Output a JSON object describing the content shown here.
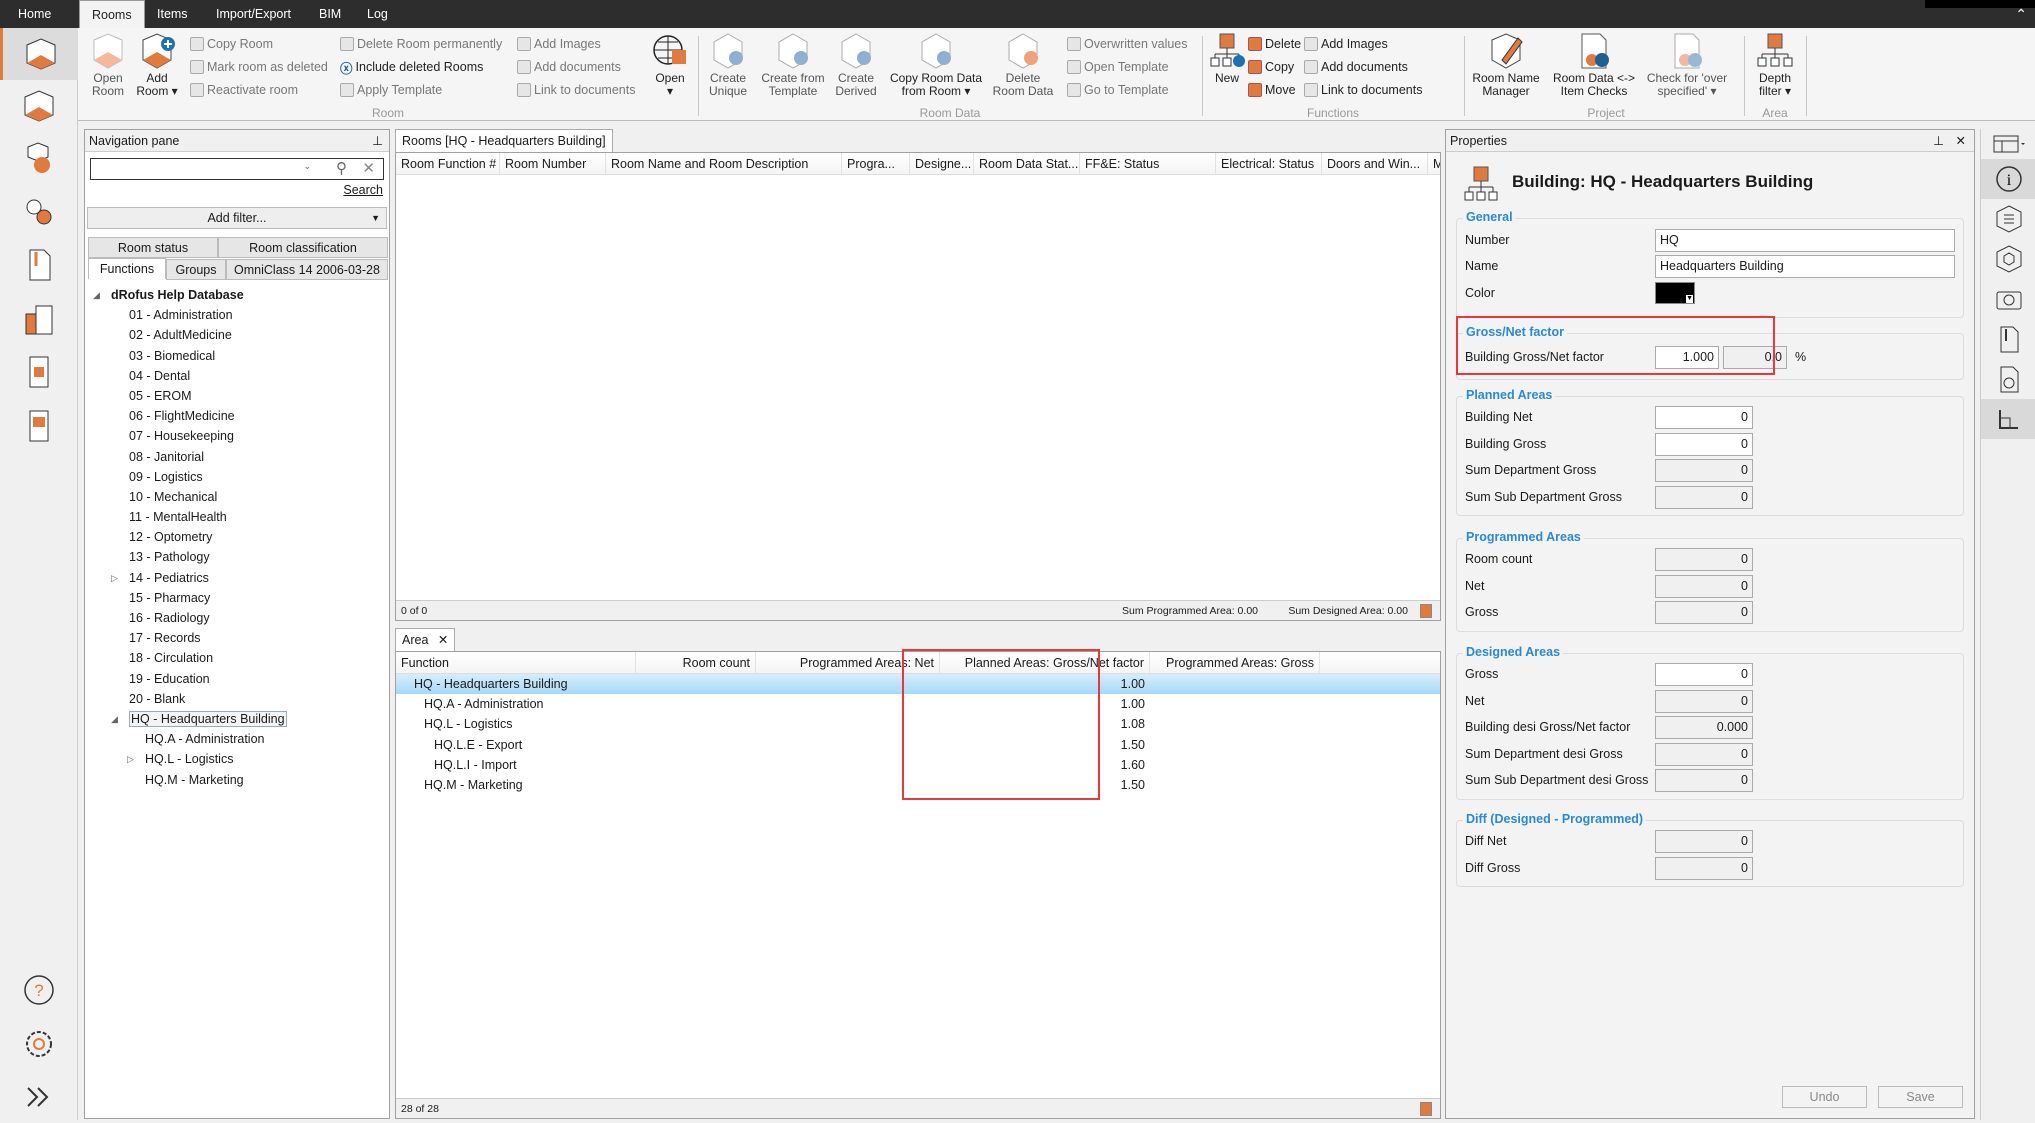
{
  "menu_tabs": [
    {
      "label": "Home"
    },
    {
      "label": "Rooms"
    },
    {
      "label": "Items"
    },
    {
      "label": "Import/Export"
    },
    {
      "label": "BIM"
    },
    {
      "label": "Log"
    }
  ],
  "ribbon": {
    "room": {
      "label": "Room",
      "open_room": "Open Room",
      "add_room": "Add Room ▾",
      "copy_room": "Copy Room",
      "mark_deleted": "Mark room as deleted",
      "reactivate": "Reactivate room",
      "delete_perm": "Delete Room permanently",
      "include_deleted": "Include deleted Rooms",
      "apply_template": "Apply Template",
      "add_images": "Add Images",
      "add_documents": "Add documents",
      "link_documents": "Link to documents",
      "open": "Open ▾"
    },
    "room_data": {
      "label": "Room Data",
      "create_unique": "Create Unique",
      "create_from_template": "Create from Template",
      "create_derived": "Create Derived",
      "copy_room_data": "Copy Room Data from Room ▾",
      "delete_room_data": "Delete Room Data",
      "overwritten": "Overwritten values",
      "open_template": "Open Template",
      "go_template": "Go to Template"
    },
    "functions": {
      "label": "Functions",
      "new": "New",
      "delete": "Delete",
      "copy": "Copy",
      "move": "Move",
      "add_images": "Add Images",
      "add_documents": "Add documents",
      "link_documents": "Link to documents"
    },
    "project": {
      "label": "Project",
      "room_name_manager": "Room Name Manager",
      "item_checks": "Room Data <-> Item Checks",
      "over_specified": "Check for 'over specified' ▾"
    },
    "area": {
      "label": "Area",
      "depth_filter": "Depth filter ▾"
    }
  },
  "nav": {
    "title": "Navigation pane",
    "search_value": "",
    "search_link": "Search",
    "add_filter": "Add filter...",
    "tabs_row1": [
      "Room status",
      "Room classification"
    ],
    "tabs_row2": [
      "Functions",
      "Groups",
      "OmniClass 14 2006-03-28"
    ],
    "tree": [
      {
        "label": "dRofus Help Database",
        "level": 0,
        "expander": "open",
        "bold": true
      },
      {
        "label": "01 - Administration",
        "level": 1
      },
      {
        "label": "02 - AdultMedicine",
        "level": 1
      },
      {
        "label": "03 - Biomedical",
        "level": 1
      },
      {
        "label": "04 - Dental",
        "level": 1
      },
      {
        "label": "05 - EROM",
        "level": 1
      },
      {
        "label": "06 - FlightMedicine",
        "level": 1
      },
      {
        "label": "07 - Housekeeping",
        "level": 1
      },
      {
        "label": "08 - Janitorial",
        "level": 1
      },
      {
        "label": "09 - Logistics",
        "level": 1
      },
      {
        "label": "10 - Mechanical",
        "level": 1
      },
      {
        "label": "11 - MentalHealth",
        "level": 1
      },
      {
        "label": "12 - Optometry",
        "level": 1
      },
      {
        "label": "13 - Pathology",
        "level": 1
      },
      {
        "label": "14 - Pediatrics",
        "level": 1,
        "expander": "closed"
      },
      {
        "label": "15 - Pharmacy",
        "level": 1
      },
      {
        "label": "16 - Radiology",
        "level": 1
      },
      {
        "label": "17 - Records",
        "level": 1
      },
      {
        "label": "18 - Circulation",
        "level": 1
      },
      {
        "label": "19 - Education",
        "level": 1
      },
      {
        "label": "20 - Blank",
        "level": 1
      },
      {
        "label": "HQ - Headquarters Building",
        "level": 1,
        "expander": "open",
        "selected": true
      },
      {
        "label": "HQ.A - Administration",
        "level": 2
      },
      {
        "label": "HQ.L - Logistics",
        "level": 2,
        "expander": "closed"
      },
      {
        "label": "HQ.M - Marketing",
        "level": 2
      }
    ]
  },
  "rooms": {
    "tab": "Rooms [HQ - Headquarters Building]",
    "columns": [
      "Room Function #",
      "Room Number",
      "Room Name and Room Description",
      "Progra...",
      "Designe...",
      "Room Data Stat...",
      "FF&E: Status",
      "Electrical: Status",
      "Doors and Win...",
      "Mecha"
    ],
    "count": "0 of 0",
    "sum_programmed": "Sum Programmed Area: 0.00",
    "sum_designed": "Sum Designed Area: 0.00"
  },
  "area": {
    "tab": "Area",
    "close": "✕",
    "columns": [
      "Function",
      "Room count",
      "Programmed Areas: Net",
      "Planned Areas: Gross/Net factor",
      "Programmed Areas: Gross"
    ],
    "rows": [
      {
        "function": "HQ - Headquarters Building",
        "level": 0,
        "factor": "1.00",
        "selected": true
      },
      {
        "function": "HQ.A - Administration",
        "level": 1,
        "factor": "1.00"
      },
      {
        "function": "HQ.L - Logistics",
        "level": 1,
        "factor": "1.08"
      },
      {
        "function": "HQ.L.E - Export",
        "level": 2,
        "factor": "1.50"
      },
      {
        "function": "HQ.L.I - Import",
        "level": 2,
        "factor": "1.60"
      },
      {
        "function": "HQ.M - Marketing",
        "level": 1,
        "factor": "1.50"
      }
    ],
    "count": "28 of 28"
  },
  "properties": {
    "title": "Properties",
    "heading": "Building: HQ - Headquarters Building",
    "general": {
      "label": "General",
      "number_label": "Number",
      "number": "HQ",
      "name_label": "Name",
      "name": "Headquarters Building",
      "color_label": "Color",
      "color": "#000000"
    },
    "gross_net": {
      "label": "Gross/Net factor",
      "factor_label": "Building Gross/Net factor",
      "factor": "1.000",
      "percent": "0.0",
      "unit": "%"
    },
    "planned": {
      "label": "Planned Areas",
      "rows": [
        {
          "label": "Building Net",
          "value": "0",
          "editable": true
        },
        {
          "label": "Building Gross",
          "value": "0",
          "editable": true
        },
        {
          "label": "Sum Department Gross",
          "value": "0"
        },
        {
          "label": "Sum Sub Department Gross",
          "value": "0"
        }
      ]
    },
    "programmed": {
      "label": "Programmed Areas",
      "rows": [
        {
          "label": "Room count",
          "value": "0"
        },
        {
          "label": "Net",
          "value": "0"
        },
        {
          "label": "Gross",
          "value": "0"
        }
      ]
    },
    "designed": {
      "label": "Designed Areas",
      "rows": [
        {
          "label": "Gross",
          "value": "0",
          "editable": true
        },
        {
          "label": "Net",
          "value": "0"
        },
        {
          "label": "Building desi Gross/Net factor",
          "value": "0.000"
        },
        {
          "label": "Sum Department desi Gross",
          "value": "0"
        },
        {
          "label": "Sum Sub Department desi Gross",
          "value": "0"
        }
      ]
    },
    "diff": {
      "label": "Diff (Designed - Programmed)",
      "rows": [
        {
          "label": "Diff Net",
          "value": "0"
        },
        {
          "label": "Diff Gross",
          "value": "0"
        }
      ]
    },
    "undo": "Undo",
    "save": "Save"
  },
  "colors": {
    "accent": "#e07a3f",
    "highlight": "#e8383d",
    "section": "#2a8ad4",
    "selection": "#a8d8f8"
  }
}
